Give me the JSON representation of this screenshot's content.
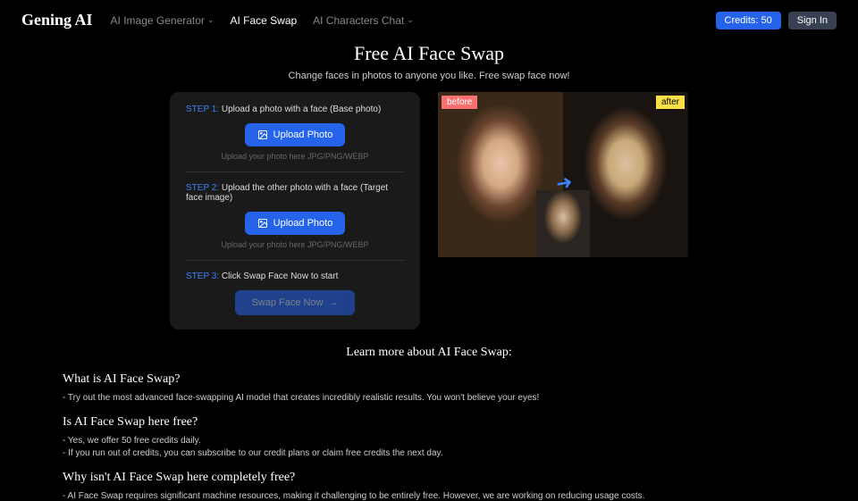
{
  "header": {
    "logo": "Gening AI",
    "nav": [
      {
        "label": "AI Image Generator",
        "hasChevron": true
      },
      {
        "label": "AI Face Swap",
        "hasChevron": false
      },
      {
        "label": "AI Characters Chat",
        "hasChevron": true
      }
    ],
    "credits": "Credits: 50",
    "signin": "Sign In"
  },
  "hero": {
    "title": "Free AI Face Swap",
    "subtitle": "Change faces in photos to anyone you like. Free swap face now!"
  },
  "steps": {
    "s1num": "STEP 1:",
    "s1text": "Upload a photo with a face (Base photo)",
    "s2num": "STEP 2:",
    "s2text": "Upload the other photo with a face (Target face image)",
    "s3num": "STEP 3:",
    "s3text": "Click Swap Face Now to start",
    "uploadBtn": "Upload Photo",
    "uploadHint": "Upload your photo here JPG/PNG/WEBP",
    "swapBtn": "Swap Face Now"
  },
  "preview": {
    "before": "before",
    "after": "after"
  },
  "learn": {
    "title": "Learn more about AI Face Swap:",
    "q1": "What is AI Face Swap?",
    "a1": "- Try out the most advanced face-swapping AI model that creates incredibly realistic results. You won't believe your eyes!",
    "q2": "Is AI Face Swap here free?",
    "a2a": "- Yes, we offer 50 free credits daily.",
    "a2b": "- If you run out of credits, you can subscribe to our credit plans or claim free credits the next day.",
    "q3": "Why isn't AI Face Swap here completely free?",
    "a3": "- AI Face Swap requires significant machine resources, making it challenging to be entirely free. However, we are working on reducing usage costs."
  }
}
